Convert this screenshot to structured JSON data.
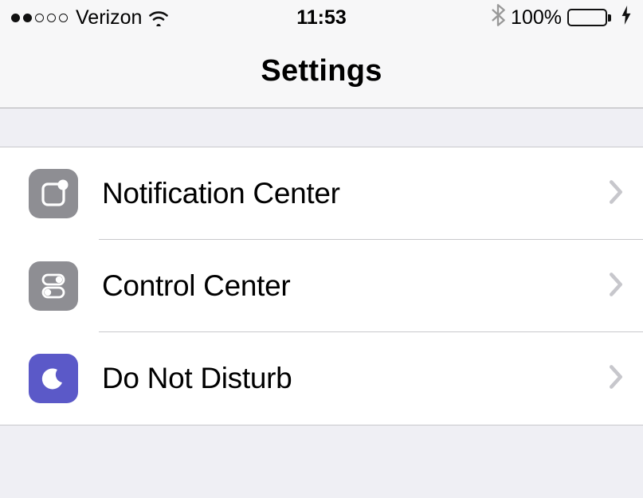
{
  "statusBar": {
    "carrier": "Verizon",
    "time": "11:53",
    "batteryPercent": "100%"
  },
  "header": {
    "title": "Settings"
  },
  "rows": [
    {
      "label": "Notification Center"
    },
    {
      "label": "Control Center"
    },
    {
      "label": "Do Not Disturb"
    }
  ]
}
